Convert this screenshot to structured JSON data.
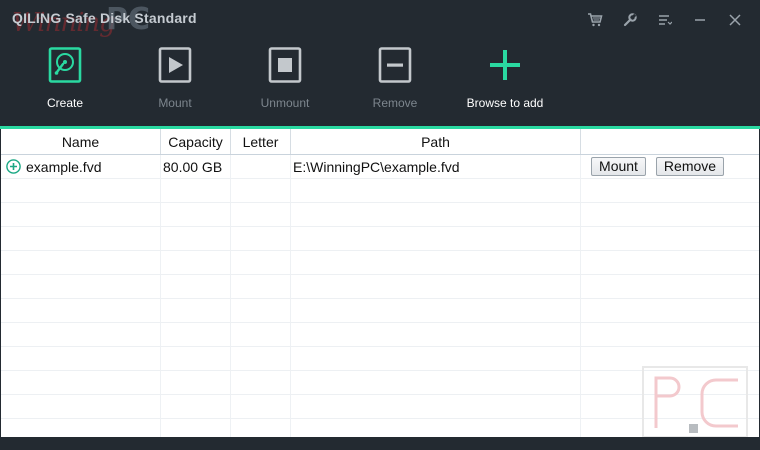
{
  "app": {
    "title": "QILING Safe Disk Standard",
    "watermark_logo_text": "WinningPC"
  },
  "window_controls": [
    {
      "name": "cart-icon"
    },
    {
      "name": "wrench-icon"
    },
    {
      "name": "menu-icon"
    },
    {
      "name": "minimize-icon"
    },
    {
      "name": "close-icon"
    }
  ],
  "toolbar": {
    "create": "Create",
    "mount": "Mount",
    "unmount": "Unmount",
    "remove": "Remove",
    "browse": "Browse to add"
  },
  "table": {
    "headers": {
      "name": "Name",
      "capacity": "Capacity",
      "letter": "Letter",
      "path": "Path",
      "actions": ""
    },
    "rows": [
      {
        "name": "example.fvd",
        "capacity": "80.00 GB",
        "letter": "",
        "path": "E:\\WinningPC\\example.fvd",
        "mount_label": "Mount",
        "remove_label": "Remove"
      }
    ]
  },
  "colors": {
    "background": "#232a31",
    "accent": "#2ad9a1",
    "disabled_text": "#7d868e"
  }
}
